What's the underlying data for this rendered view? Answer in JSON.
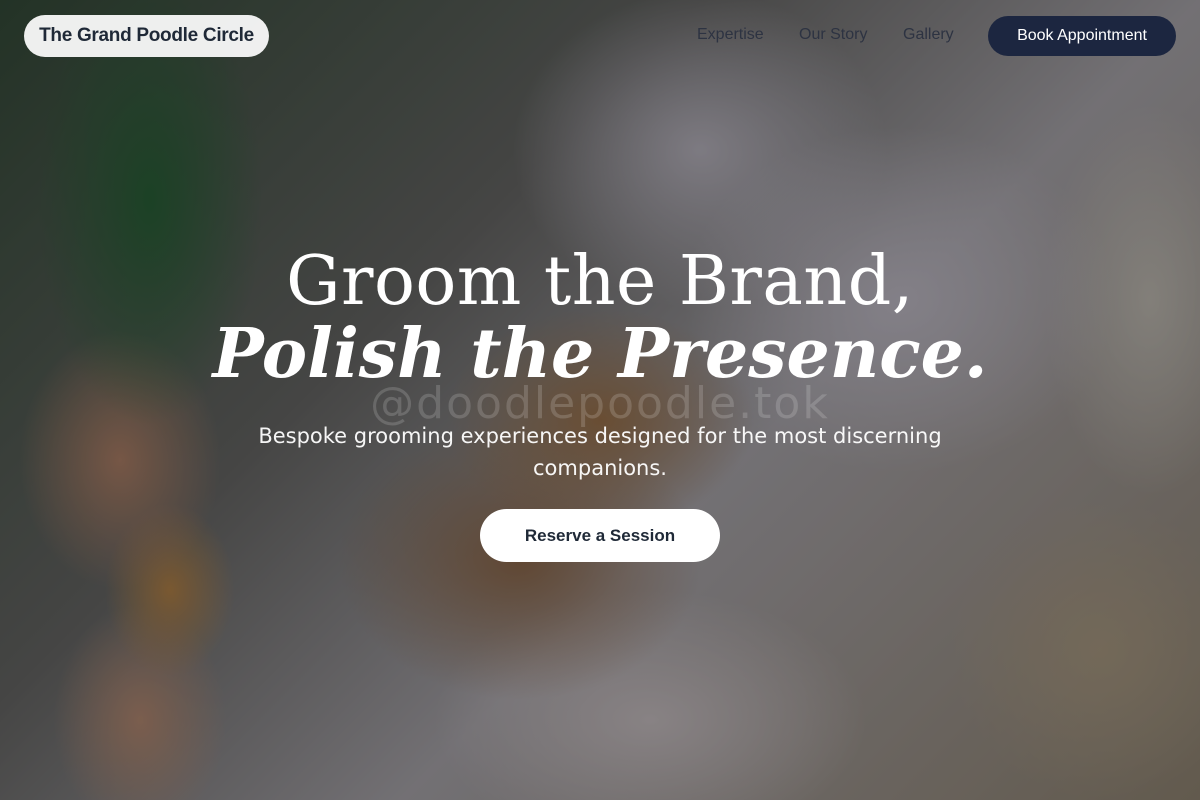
{
  "brand": {
    "name": "The Grand Poodle Circle"
  },
  "nav": {
    "links": [
      "Expertise",
      "Our Story",
      "Gallery"
    ],
    "cta_label": "Book Appointment"
  },
  "hero": {
    "title_line1": "Groom the Brand,",
    "title_line2": "Polish the Presence.",
    "watermark": "@doodlepoodle.tok",
    "subtitle": "Bespoke grooming experiences designed for the most discerning companions.",
    "cta_label": "Reserve a Session"
  },
  "colors": {
    "primary_dark": "#1c2640",
    "text_dark": "#1f2937",
    "white": "#ffffff"
  }
}
